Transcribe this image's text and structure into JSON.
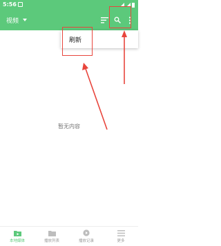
{
  "status_bar": {
    "time": "5:56"
  },
  "app_bar": {
    "dropdown_label": "视频",
    "sort_icon": "sort-icon",
    "search_icon": "search-icon",
    "more_icon": "more-vert-icon"
  },
  "menu": {
    "refresh_label": "刷新"
  },
  "content": {
    "empty_text": "暂无内容"
  },
  "bottom_nav": {
    "tabs": [
      {
        "label": "本地媒体",
        "icon": "local-media-icon",
        "active": true
      },
      {
        "label": "播放列表",
        "icon": "folder-icon",
        "active": false
      },
      {
        "label": "播放记录",
        "icon": "history-icon",
        "active": false
      },
      {
        "label": "更多",
        "icon": "menu-icon",
        "active": false
      }
    ]
  },
  "colors": {
    "primary": "#5cc97b",
    "annotation": "#e8453c",
    "inactive": "#9b9b9b"
  }
}
